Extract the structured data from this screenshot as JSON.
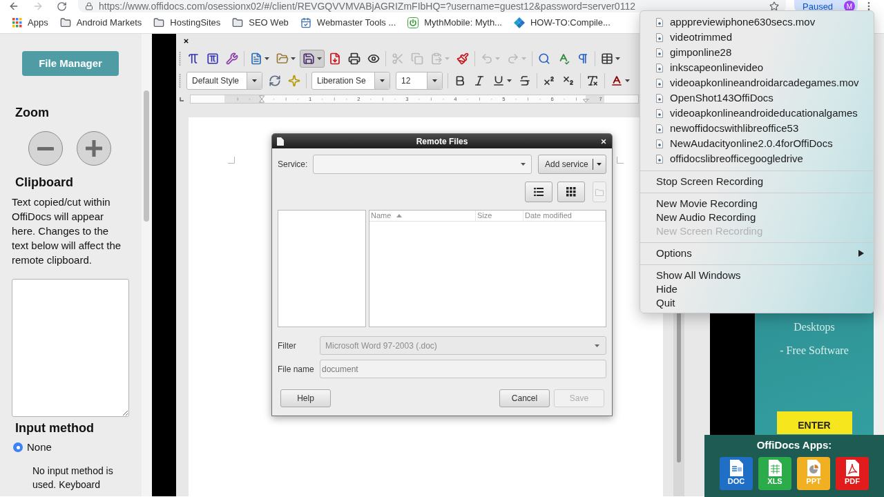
{
  "browser": {
    "url": "https://www.offidocs.com/osessionx02/#/client/REVGQVVMVABjAGRIZmFIbHQ=?username=guest12&password=server0112",
    "profile_status": "Paused",
    "avatar": "M"
  },
  "bookmarks": [
    {
      "kind": "apps",
      "label": "Apps"
    },
    {
      "kind": "folder",
      "label": "Android Markets"
    },
    {
      "kind": "folder",
      "label": "HostingSites"
    },
    {
      "kind": "folder",
      "label": "SEO Web"
    },
    {
      "kind": "calendar",
      "label": "Webmaster Tools ..."
    },
    {
      "kind": "power",
      "label": "MythMobile: Myth..."
    },
    {
      "kind": "tiles",
      "label": "HOW-TO:Compile..."
    }
  ],
  "sidebar": {
    "file_manager_button": "File Manager",
    "zoom_heading": "Zoom",
    "clipboard_heading": "Clipboard",
    "clipboard_text": "Text copied/cut within OffiDocs will appear here. Changes to the text below will affect the remote clipboard.",
    "input_method_heading": "Input method",
    "input_methods": [
      {
        "label": "None",
        "selected": true
      }
    ],
    "input_method_note": "No input method is used. Keyboard"
  },
  "writer": {
    "toolbars": [
      [
        [
          {
            "kind": "formula",
            "disabled": false,
            "pressed": false,
            "dropdown": false
          },
          {
            "kind": "object",
            "disabled": false,
            "pressed": false,
            "dropdown": false
          },
          {
            "kind": "tools",
            "disabled": false,
            "pressed": false,
            "dropdown": false
          }
        ],
        [
          {
            "kind": "new",
            "disabled": false,
            "pressed": false,
            "dropdown": true
          },
          {
            "kind": "open",
            "disabled": false,
            "pressed": false,
            "dropdown": true
          },
          {
            "kind": "save",
            "disabled": false,
            "pressed": true,
            "dropdown": true
          },
          {
            "kind": "pdf",
            "disabled": false,
            "pressed": false,
            "dropdown": false
          },
          {
            "kind": "print",
            "disabled": false,
            "pressed": false,
            "dropdown": false
          },
          {
            "kind": "preview",
            "disabled": false,
            "pressed": false,
            "dropdown": false
          }
        ],
        [
          {
            "kind": "cut",
            "disabled": true,
            "pressed": false,
            "dropdown": false
          },
          {
            "kind": "copy",
            "disabled": true,
            "pressed": false,
            "dropdown": false
          },
          {
            "kind": "paste",
            "disabled": true,
            "pressed": false,
            "dropdown": true
          },
          {
            "kind": "clone",
            "disabled": false,
            "pressed": false,
            "dropdown": false
          }
        ],
        [
          {
            "kind": "undo",
            "disabled": true,
            "pressed": false,
            "dropdown": true
          },
          {
            "kind": "redo",
            "disabled": true,
            "pressed": false,
            "dropdown": true
          }
        ],
        [
          {
            "kind": "find",
            "disabled": false,
            "pressed": false,
            "dropdown": false
          },
          {
            "kind": "spelling",
            "disabled": false,
            "pressed": false,
            "dropdown": false
          },
          {
            "kind": "marks",
            "disabled": false,
            "pressed": false,
            "dropdown": false
          }
        ],
        [
          {
            "kind": "table",
            "disabled": false,
            "pressed": false,
            "dropdown": true
          }
        ]
      ],
      [
        [
          {
            "kind": "stylebox",
            "value": "Default Style",
            "dropdown": true
          },
          {
            "kind": "update",
            "disabled": false,
            "pressed": false,
            "dropdown": false
          },
          {
            "kind": "newstyle",
            "disabled": false,
            "pressed": false,
            "dropdown": false
          }
        ],
        [
          {
            "kind": "fontbox",
            "value": "Liberation Se",
            "dropdown": true
          },
          {
            "kind": "sizebox",
            "value": "12",
            "dropdown": true
          }
        ],
        [
          {
            "kind": "bold",
            "disabled": false,
            "pressed": false,
            "dropdown": false
          },
          {
            "kind": "italic",
            "disabled": false,
            "pressed": false,
            "dropdown": false
          },
          {
            "kind": "underline",
            "disabled": false,
            "pressed": false,
            "dropdown": true
          },
          {
            "kind": "strike",
            "disabled": false,
            "pressed": false,
            "dropdown": false
          }
        ],
        [
          {
            "kind": "superscript",
            "disabled": false,
            "pressed": false,
            "dropdown": false
          },
          {
            "kind": "subscript",
            "disabled": false,
            "pressed": false,
            "dropdown": false
          }
        ],
        [
          {
            "kind": "clear",
            "disabled": false,
            "pressed": false,
            "dropdown": false
          }
        ],
        [
          {
            "kind": "fontcolor",
            "disabled": false,
            "pressed": false,
            "dropdown": true
          }
        ]
      ]
    ],
    "ruler": {
      "labels": [
        "1",
        "2",
        "3",
        "4",
        "5",
        "6",
        "7"
      ]
    }
  },
  "dialog": {
    "title": "Remote Files",
    "service_label": "Service:",
    "add_service": "Add service",
    "view_buttons": [
      {
        "kind": "list",
        "disabled": false
      },
      {
        "kind": "grid",
        "disabled": false
      },
      {
        "kind": "folder",
        "disabled": true
      }
    ],
    "columns": [
      {
        "label": "Name",
        "sorted": true
      },
      {
        "label": "Size",
        "sorted": false
      },
      {
        "label": "Date modified",
        "sorted": false
      }
    ],
    "filter": {
      "label": "Filter",
      "value": "Microsoft Word 97-2003 (.doc)",
      "disabled": true
    },
    "file_name": {
      "label": "File name",
      "value": "document"
    },
    "help_button": {
      "label": "Help",
      "disabled": false
    },
    "buttons": [
      {
        "label": "Cancel",
        "disabled": false
      },
      {
        "label": "Save",
        "disabled": true
      }
    ]
  },
  "recording_menu": {
    "recent_files": [
      "apppreviewiphone630secs.mov",
      "videotrimmed",
      "gimponline28",
      "inkscapeonlinevideo",
      "videoapkonlineandroidarcadegames.mov",
      "OpenShot143OffiDocs",
      "videoapkonlineandroideducationalgames",
      "newoffidocswithlibreoffice53",
      "NewAudacityonline2.0.4forOffiDocs",
      "offidocslibreofficegoogledrive"
    ],
    "groups": [
      [
        {
          "label": "Stop Screen Recording",
          "disabled": false,
          "submenu": false
        }
      ],
      [
        {
          "label": "New Movie Recording",
          "disabled": false,
          "submenu": false
        },
        {
          "label": "New Audio Recording",
          "disabled": false,
          "submenu": false
        },
        {
          "label": "New Screen Recording",
          "disabled": true,
          "submenu": false
        }
      ],
      [
        {
          "label": "Options",
          "disabled": false,
          "submenu": true
        }
      ],
      [
        {
          "label": "Show All Windows",
          "disabled": false,
          "submenu": false
        },
        {
          "label": "Hide",
          "disabled": false,
          "submenu": false
        },
        {
          "label": "Quit",
          "disabled": false,
          "submenu": false
        }
      ]
    ]
  },
  "ad": {
    "lines": [
      "Desktops",
      "- Free Software"
    ],
    "button": "ENTER"
  },
  "apps_panel": {
    "title": "OffiDocs Apps:",
    "apps": [
      {
        "kind": "doc",
        "label": "DOC",
        "color": "#1f6fc6"
      },
      {
        "kind": "xls",
        "label": "XLS",
        "color": "#2cab4b"
      },
      {
        "kind": "ppt",
        "label": "PPT",
        "color": "#f0b021"
      },
      {
        "kind": "pdf",
        "label": "PDF",
        "color": "#e01c1c"
      }
    ]
  }
}
